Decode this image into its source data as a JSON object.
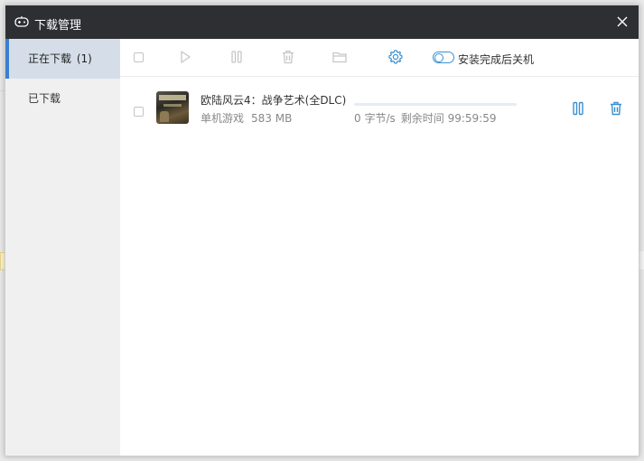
{
  "window": {
    "title": "下载管理"
  },
  "sidebar": {
    "items": [
      {
        "label": "正在下载",
        "count": "(1)"
      },
      {
        "label": "已下载"
      }
    ]
  },
  "toolbar": {
    "shutdown_label": "安装完成后关机",
    "shutdown_enabled": false,
    "accent_color": "#3a8fd0"
  },
  "downloads": [
    {
      "name": "欧陆风云4：战争艺术(全DLC)",
      "category": "单机游戏",
      "size": "583 MB",
      "speed": "0 字节/s",
      "remaining": "剩余时间 99:59:59",
      "progress": 0
    }
  ],
  "icons": [
    "gamepad-icon",
    "close-icon",
    "play-icon",
    "pause-icon",
    "trash-icon",
    "folder-icon",
    "gear-icon"
  ]
}
